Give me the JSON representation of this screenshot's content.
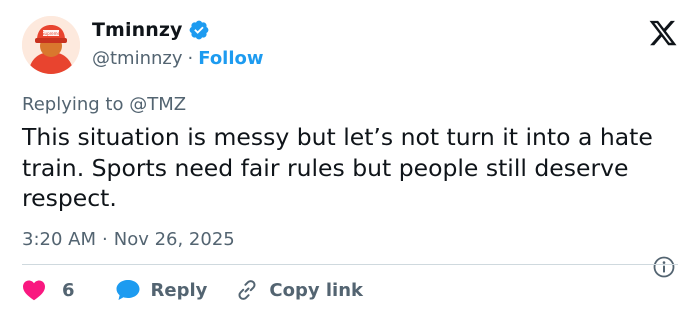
{
  "user": {
    "display_name": "Tminnzy",
    "handle": "@tminnzy",
    "separator": "·",
    "follow_label": "Follow",
    "avatar_cap_text": "Supreme"
  },
  "tweet": {
    "replying_prefix": "Replying to",
    "replying_to": "@TMZ",
    "text": "This situation is messy but let’s not turn it into a hate train. Sports need fair rules but people still deserve respect.",
    "time": "3:20 AM",
    "separator": "·",
    "date": "Nov 26, 2025"
  },
  "actions": {
    "like_count": "6",
    "reply_label": "Reply",
    "copy_link_label": "Copy link"
  },
  "icons": {
    "brand": "x-logo",
    "verified": "verified-badge-icon",
    "info": "info-icon",
    "like": "heart-icon",
    "reply": "speech-bubble-icon",
    "link": "link-icon"
  },
  "colors": {
    "accent": "#1d9bf0",
    "like": "#f91880",
    "text_primary": "#0f1419",
    "text_secondary": "#536471",
    "divider": "#cfd9de"
  }
}
